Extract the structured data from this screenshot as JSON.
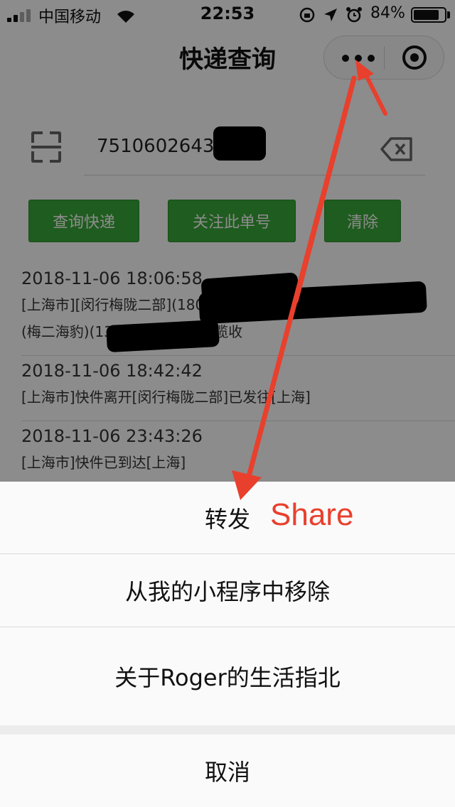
{
  "status_bar": {
    "carrier": "中国移动",
    "time": "22:53",
    "battery": "84%",
    "battery_level": 0.84
  },
  "nav": {
    "title": "快递查询",
    "more_icon": "more-dots-icon",
    "close_icon": "miniprogram-close-icon"
  },
  "search": {
    "value": "75106026433535",
    "scan_icon": "scan-icon",
    "clear_icon": "backspace-clear-icon"
  },
  "buttons": {
    "query": "查询快递",
    "follow": "关注此单号",
    "clear": "清除"
  },
  "records": [
    {
      "time": "2018-11-06 18:06:58",
      "line1": "[上海市][闵行梅陇二部](18066...      18964179089)的",
      "line2": "(梅二海豹)(13701604337)已揽收"
    },
    {
      "time": "2018-11-06 18:42:42",
      "line1": "[上海市]快件离开[闵行梅陇二部]已发往[上海]",
      "line2": ""
    },
    {
      "time": "2018-11-06 23:43:26",
      "line1": "[上海市]快件已到达[上海]",
      "line2": ""
    }
  ],
  "action_sheet": {
    "share": "转发",
    "remove": "从我的小程序中移除",
    "about": "关于Roger的生活指北",
    "cancel": "取消"
  },
  "annotation": {
    "label": "Share",
    "color": "#e8402d"
  },
  "colors": {
    "button_green": "#3aa83a",
    "annotation_red": "#e8402d"
  }
}
